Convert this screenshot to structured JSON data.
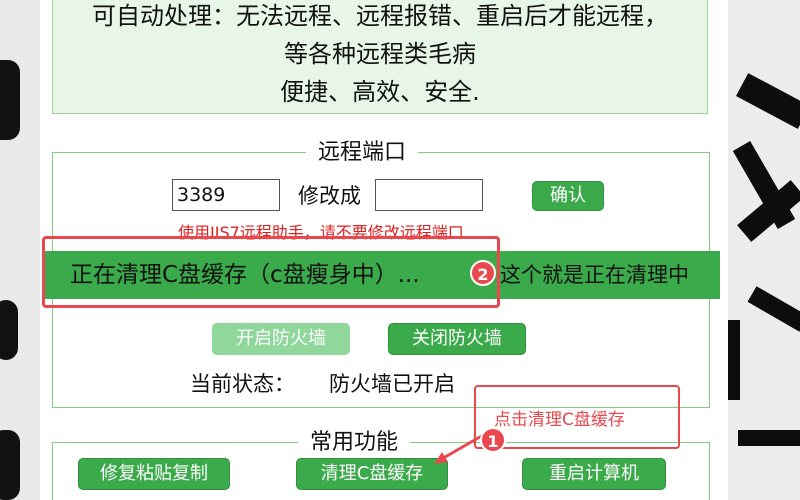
{
  "top_notice": {
    "line1": "可自动处理：无法远程、远程报错、重启后才能远程，",
    "line2": "等各种远程类毛病",
    "line3": "便捷、高效、安全."
  },
  "remote_port": {
    "legend": "远程端口",
    "current_port_value": "3389",
    "modify_label": "修改成",
    "new_port_value": "",
    "confirm_label": "确认",
    "warning": "使用IIS7远程助手，请不要修改远程端口"
  },
  "cleanup_banner": {
    "status_text": "正在清理C盘缓存（c盘瘦身中）...",
    "note": "这个就是正在清理中",
    "badge": "2"
  },
  "firewall": {
    "enable_label": "开启防火墙",
    "disable_label": "关闭防火墙",
    "status_label": "当前状态：",
    "status_value": "防火墙已开启"
  },
  "common_functions": {
    "legend": "常用功能",
    "buttons": [
      "修复粘贴复制",
      "清理C盘缓存",
      "重启计算机"
    ]
  },
  "annotation_1": {
    "text": "点击清理C盘缓存",
    "badge": "1"
  },
  "colors": {
    "green": "#3aaa4a",
    "light_green": "#8fd79b",
    "red_annotation": "#e8484e",
    "warning_red": "#e02020",
    "notice_bg": "#e7f6e7"
  }
}
